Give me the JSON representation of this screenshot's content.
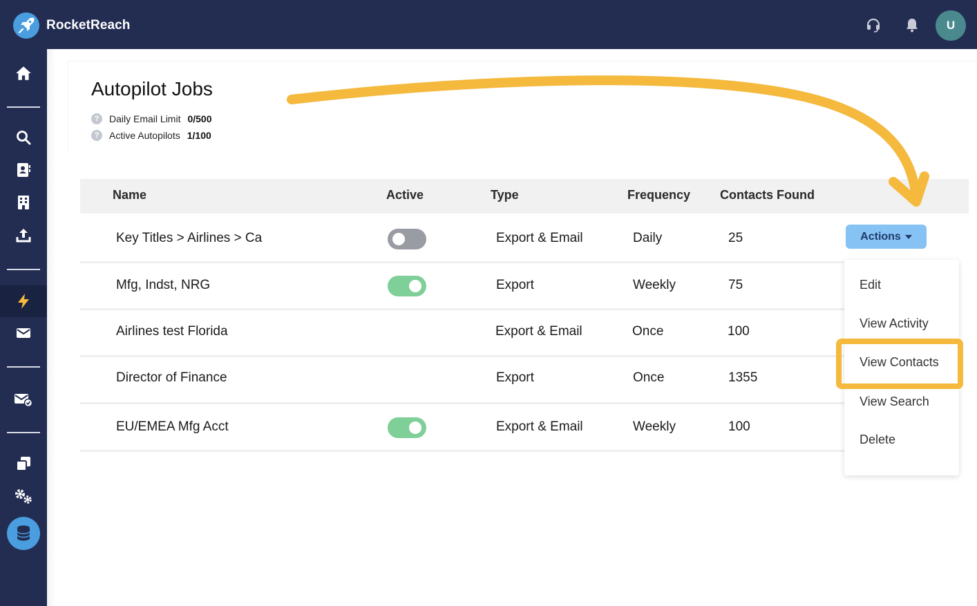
{
  "app": {
    "brand": "RocketReach",
    "user_initial": "U"
  },
  "colors": {
    "navy": "#232d52",
    "toggle_on": "#7fcf98",
    "toggle_off": "#9a9ca3",
    "actions_button": "#86c2f4",
    "highlight": "#f4b93d"
  },
  "topbar": {
    "icons": [
      "headset-icon",
      "bell-icon"
    ]
  },
  "sidebar": {
    "items": [
      "home-icon",
      "search-icon",
      "contacts-icon",
      "building-icon",
      "upload-icon",
      "bolt-icon",
      "mail-icon",
      "mail-check-icon",
      "copy-icon",
      "gears-icon",
      "tags-icon",
      "database-icon"
    ],
    "active": "bolt-icon"
  },
  "page": {
    "title": "Autopilot Jobs",
    "stats": [
      {
        "label": "Daily Email Limit",
        "value": "0/500"
      },
      {
        "label": "Active Autopilots",
        "value": "1/100"
      }
    ]
  },
  "table": {
    "headers": [
      "Name",
      "Active",
      "Type",
      "Frequency",
      "Contacts Found"
    ],
    "rows": [
      {
        "name": "Key Titles > Airlines > Ca",
        "active": "off",
        "type": "Export & Email",
        "frequency": "Daily",
        "contacts": "25"
      },
      {
        "name": "Mfg, Indst, NRG",
        "active": "on",
        "type": "Export",
        "frequency": "Weekly",
        "contacts": "75"
      },
      {
        "name": "Airlines test Florida",
        "active": "none",
        "type": "Export & Email",
        "frequency": "Once",
        "contacts": "100"
      },
      {
        "name": "Director of Finance",
        "active": "none",
        "type": "Export",
        "frequency": "Once",
        "contacts": "1355"
      },
      {
        "name": "EU/EMEA Mfg Acct",
        "active": "on",
        "type": "Export & Email",
        "frequency": "Weekly",
        "contacts": "100"
      }
    ]
  },
  "actions": {
    "button_label": "Actions",
    "menu": [
      "Edit",
      "View Activity",
      "View Contacts",
      "View Search",
      "Delete"
    ],
    "highlighted": "View Contacts"
  }
}
